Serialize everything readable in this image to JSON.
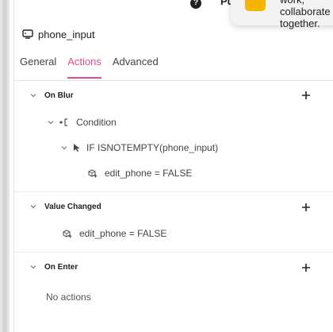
{
  "topbar": {
    "help_glyph": "?",
    "publish_label": "Pu"
  },
  "toast": {
    "text": "work, collaborate together."
  },
  "component": {
    "name": "phone_input",
    "icon": "component-icon"
  },
  "tabs": [
    {
      "label": "General"
    },
    {
      "label": "Actions"
    },
    {
      "label": "Advanced"
    }
  ],
  "active_tab": "Actions",
  "accent_color": "#e8488c",
  "sections": {
    "on_blur": {
      "title": "On Blur",
      "condition_label": "Condition",
      "if_label": "IF ISNOTEMPTY(phone_input)",
      "action_label": "edit_phone = FALSE"
    },
    "value_changed": {
      "title": "Value Changed",
      "action_label": "edit_phone = FALSE"
    },
    "on_enter": {
      "title": "On Enter",
      "empty_label": "No actions"
    }
  }
}
